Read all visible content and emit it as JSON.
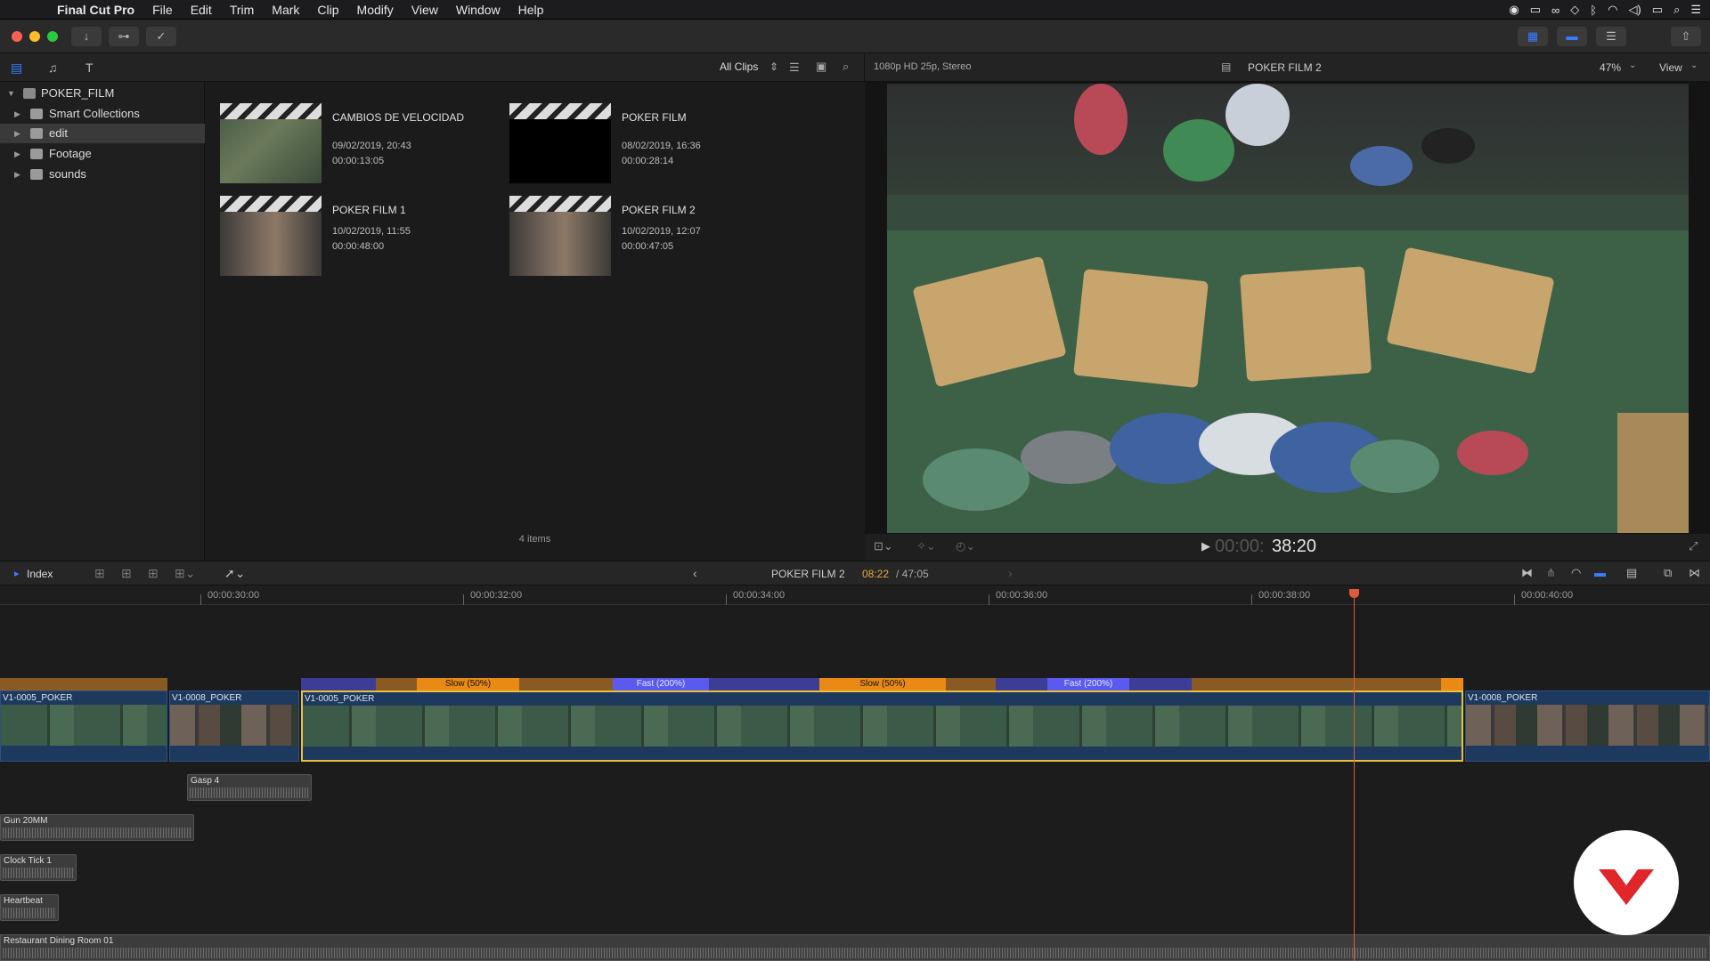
{
  "menubar": {
    "app": "Final Cut Pro",
    "items": [
      "File",
      "Edit",
      "Trim",
      "Mark",
      "Clip",
      "Modify",
      "View",
      "Window",
      "Help"
    ]
  },
  "library": {
    "root": "POKER_FILM",
    "items": [
      {
        "label": "Smart Collections"
      },
      {
        "label": "edit"
      },
      {
        "label": "Footage"
      },
      {
        "label": "sounds"
      }
    ]
  },
  "browser": {
    "filter": "All Clips",
    "items_count": "4 items",
    "clips": [
      {
        "title": "CAMBIOS DE VELOCIDAD",
        "date": "09/02/2019, 20:43",
        "duration": "00:00:13:05"
      },
      {
        "title": "POKER FILM",
        "date": "08/02/2019, 16:36",
        "duration": "00:00:28:14"
      },
      {
        "title": "POKER FILM 1",
        "date": "10/02/2019, 11:55",
        "duration": "00:00:48:00"
      },
      {
        "title": "POKER FILM 2",
        "date": "10/02/2019, 12:07",
        "duration": "00:00:47:05"
      }
    ]
  },
  "viewer": {
    "format": "1080p HD 25p, Stereo",
    "title": "POKER FILM 2",
    "zoom": "47%",
    "view_menu": "View",
    "timecode_dim": "00:00:",
    "timecode": "38:20"
  },
  "timeline": {
    "index_label": "Index",
    "project_name": "POKER FILM 2",
    "position": "08:22",
    "total": "/ 47:05",
    "ruler": [
      "00:00:30:00",
      "00:00:32:00",
      "00:00:34:00",
      "00:00:36:00",
      "00:00:38:00",
      "00:00:40:00"
    ],
    "video_clips": [
      "V1-0005_POKER",
      "V1-0008_POKER",
      "V1-0005_POKER",
      "V1-0008_POKER"
    ],
    "speed_segments": [
      "Slow (50%)",
      "Fast (200%)",
      "Slow (50%)",
      "Fast (200%)"
    ],
    "audio_clips": [
      "Gasp 4",
      "Gun 20MM",
      "Clock Tick 1",
      "Heartbeat",
      "Restaurant Dining Room 01"
    ]
  },
  "colors": {
    "accent": "#3a7cff",
    "speed_slow": "#e98a16",
    "speed_fast": "#5a5aee",
    "playhead": "#e05a3a",
    "clip": "#1d3a5e"
  }
}
